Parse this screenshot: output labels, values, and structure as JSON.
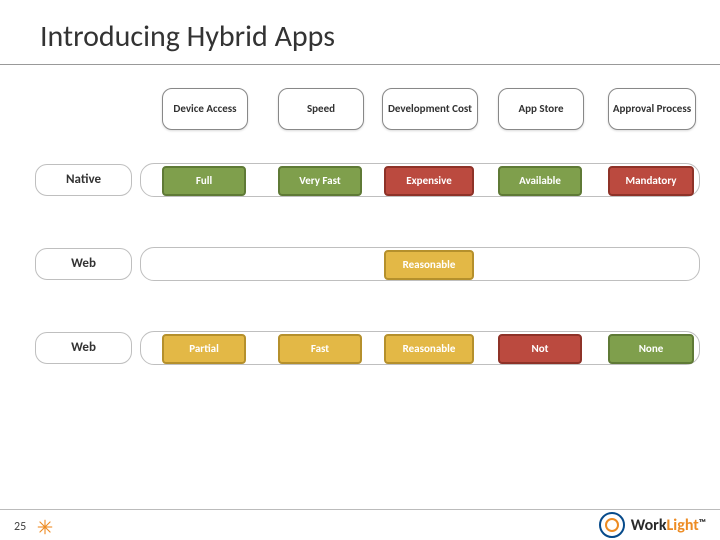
{
  "title": "Introducing Hybrid Apps",
  "headers": {
    "h1": "Device Access",
    "h2": "Speed",
    "h3": "Development Cost",
    "h4": "App Store",
    "h5": "Approval Process"
  },
  "rows": {
    "r1": {
      "label": "Native"
    },
    "r2": {
      "label": "Web"
    },
    "r3": {
      "label": "Web"
    }
  },
  "cells": {
    "r1c1": "Full",
    "r1c2": "Very Fast",
    "r1c3": "Expensive",
    "r1c4": "Available",
    "r1c5": "Mandatory",
    "r2c3": "Reasonable",
    "r3c1": "Partial",
    "r3c2": "Fast",
    "r3c3": "Reasonable",
    "r3c4": "Not",
    "r3c5": "None"
  },
  "footer": {
    "page": "25",
    "logo_a": "Work",
    "logo_b": "Light"
  },
  "chart_data": {
    "type": "table",
    "columns": [
      "Device Access",
      "Speed",
      "Development Cost",
      "App Store",
      "Approval Process"
    ],
    "rows": [
      {
        "label": "Native",
        "values": [
          "Full",
          "Very Fast",
          "Expensive",
          "Available",
          "Mandatory"
        ],
        "colors": [
          "green",
          "green",
          "red",
          "green",
          "red"
        ]
      },
      {
        "label": "Web",
        "values": [
          "",
          "",
          "Reasonable",
          "",
          ""
        ],
        "colors": [
          "",
          "",
          "yellow",
          "",
          ""
        ]
      },
      {
        "label": "Web",
        "values": [
          "Partial",
          "Fast",
          "Reasonable",
          "Not",
          "None"
        ],
        "colors": [
          "yellow",
          "yellow",
          "yellow",
          "red",
          "green"
        ]
      }
    ]
  }
}
